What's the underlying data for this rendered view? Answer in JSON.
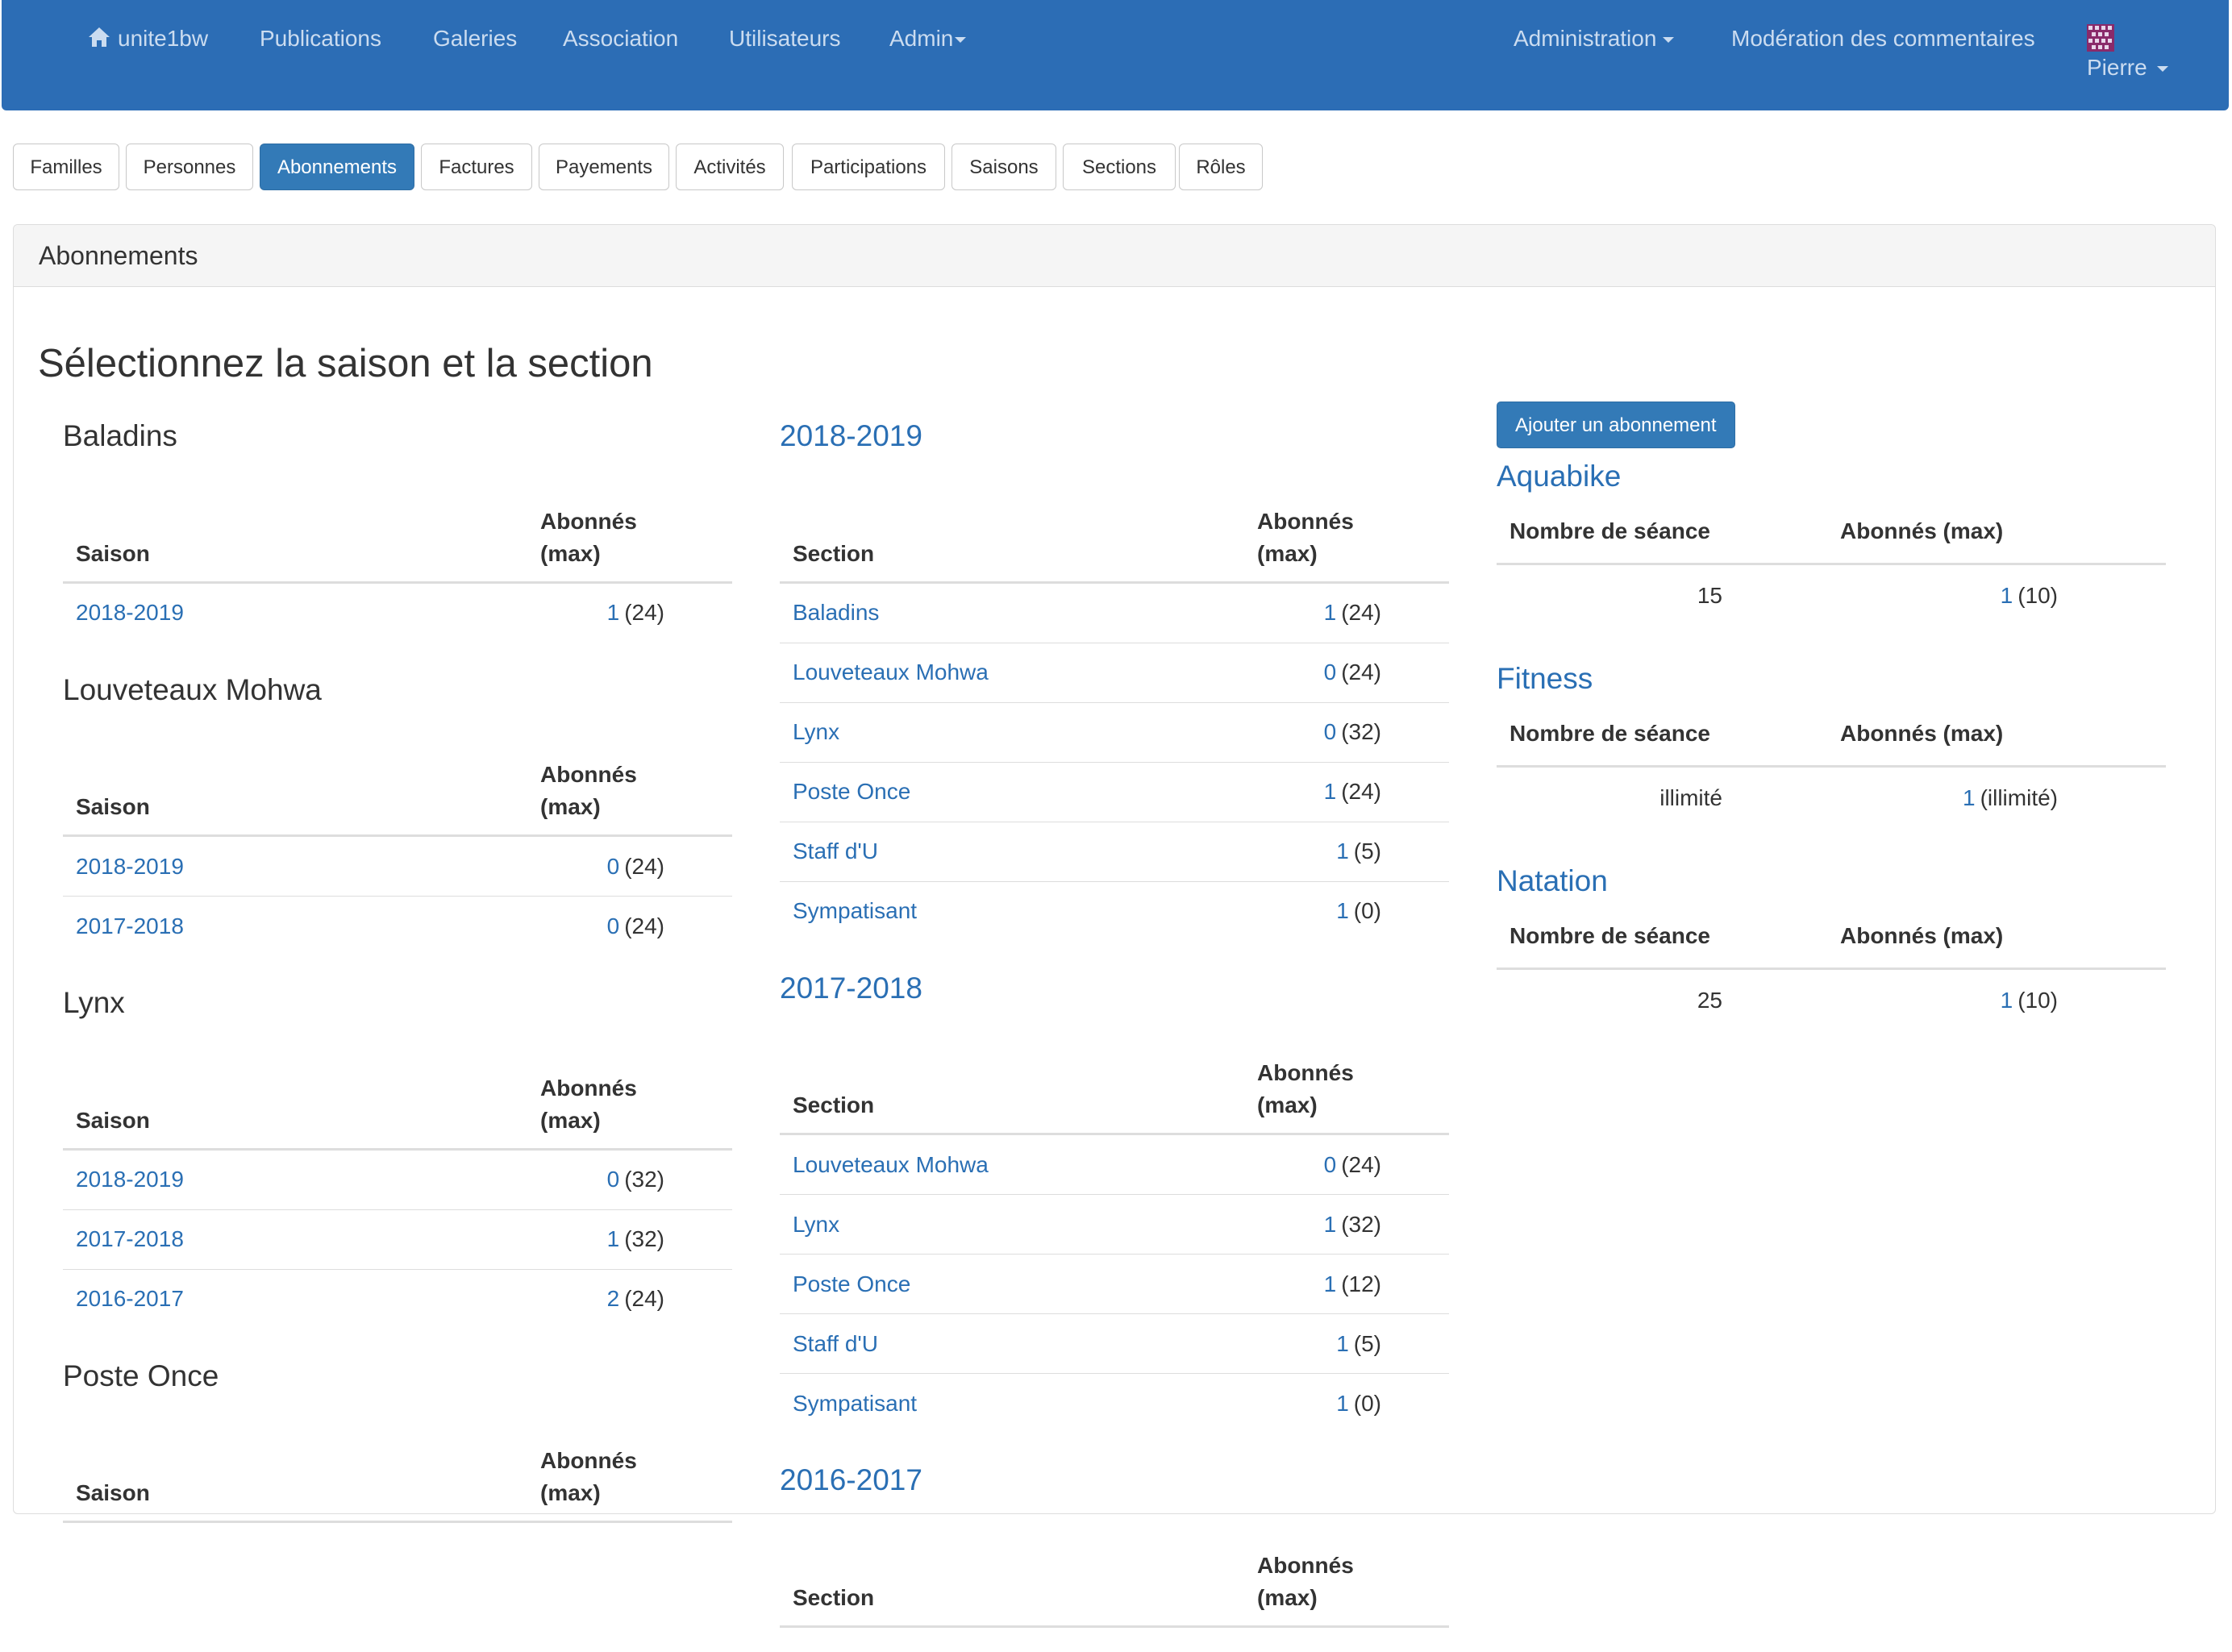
{
  "navbar": {
    "brand": "unite1bw",
    "items": [
      "Publications",
      "Galeries",
      "Association",
      "Utilisateurs",
      "Admin"
    ],
    "right": {
      "administration": "Administration",
      "moderation": "Modération des commentaires",
      "user": "Pierre"
    }
  },
  "tabs": [
    "Familles",
    "Personnes",
    "Abonnements",
    "Factures",
    "Payements",
    "Activités",
    "Participations",
    "Saisons",
    "Sections",
    "Rôles"
  ],
  "active_tab": "Abonnements",
  "panel": {
    "heading": "Abonnements",
    "title": "Sélectionnez la saison et la section"
  },
  "by_section": {
    "col_saison": "Saison",
    "col_abonnes_1": "Abonnés",
    "col_abonnes_2": "(max)",
    "groups": [
      {
        "name": "Baladins",
        "rows": [
          {
            "saison": "2018-2019",
            "count": "1",
            "max": "(24)"
          }
        ]
      },
      {
        "name": "Louveteaux Mohwa",
        "rows": [
          {
            "saison": "2018-2019",
            "count": "0",
            "max": "(24)"
          },
          {
            "saison": "2017-2018",
            "count": "0",
            "max": "(24)"
          }
        ]
      },
      {
        "name": "Lynx",
        "rows": [
          {
            "saison": "2018-2019",
            "count": "0",
            "max": "(32)"
          },
          {
            "saison": "2017-2018",
            "count": "1",
            "max": "(32)"
          },
          {
            "saison": "2016-2017",
            "count": "2",
            "max": "(24)"
          }
        ]
      },
      {
        "name": "Poste Once",
        "rows": []
      }
    ]
  },
  "by_season": {
    "col_section": "Section",
    "col_abonnes_1": "Abonnés",
    "col_abonnes_2": "(max)",
    "groups": [
      {
        "name": "2018-2019",
        "rows": [
          {
            "section": "Baladins",
            "count": "1",
            "max": "(24)"
          },
          {
            "section": "Louveteaux Mohwa",
            "count": "0",
            "max": "(24)"
          },
          {
            "section": "Lynx",
            "count": "0",
            "max": "(32)"
          },
          {
            "section": "Poste Once",
            "count": "1",
            "max": "(24)"
          },
          {
            "section": "Staff d'U",
            "count": "1",
            "max": "(5)"
          },
          {
            "section": "Sympatisant",
            "count": "1",
            "max": "(0)"
          }
        ]
      },
      {
        "name": "2017-2018",
        "rows": [
          {
            "section": "Louveteaux Mohwa",
            "count": "0",
            "max": "(24)"
          },
          {
            "section": "Lynx",
            "count": "1",
            "max": "(32)"
          },
          {
            "section": "Poste Once",
            "count": "1",
            "max": "(12)"
          },
          {
            "section": "Staff d'U",
            "count": "1",
            "max": "(5)"
          },
          {
            "section": "Sympatisant",
            "count": "1",
            "max": "(0)"
          }
        ]
      },
      {
        "name": "2016-2017",
        "rows": []
      }
    ]
  },
  "activities": {
    "add_button": "Ajouter un abonnement",
    "col_seances": "Nombre de séance",
    "col_abonnes": "Abonnés (max)",
    "items": [
      {
        "name": "Aquabike",
        "seances": "15",
        "count": "1",
        "max": "(10)"
      },
      {
        "name": "Fitness",
        "seances": "illimité",
        "count": "1",
        "max": "(illimité)"
      },
      {
        "name": "Natation",
        "seances": "25",
        "count": "1",
        "max": "(10)"
      }
    ]
  }
}
